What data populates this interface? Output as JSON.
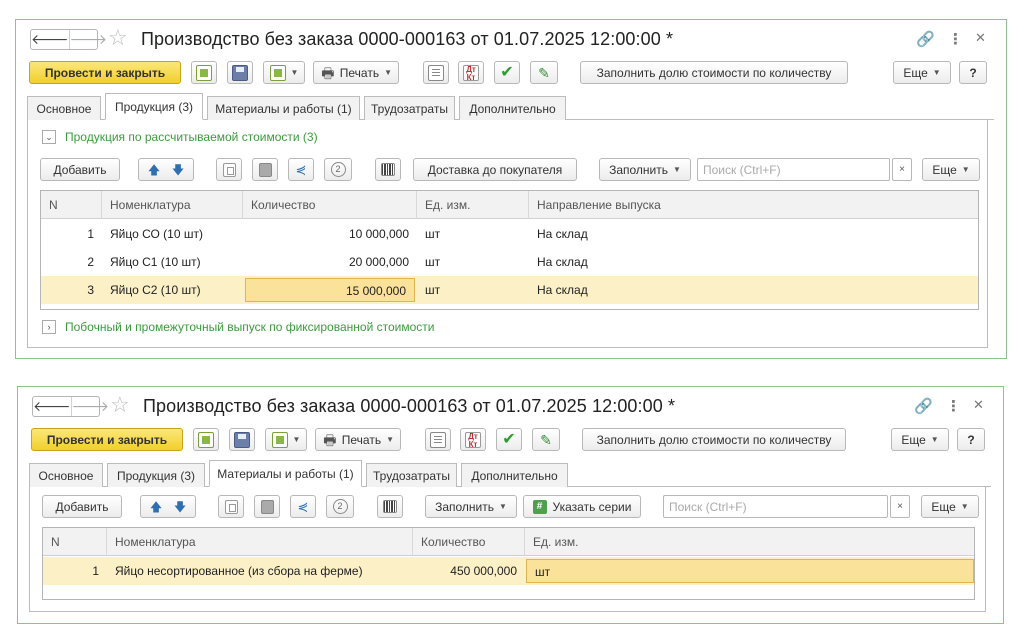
{
  "colors": {
    "accent_green": "#3c9b3c",
    "primary_button": "#f1cf2c",
    "selected_row": "#fbf0c6"
  },
  "window1": {
    "title": "Производство без заказа 0000-000163 от 01.07.2025 12:00:00 *",
    "toolbar": {
      "post_close": "Провести и закрыть",
      "print": "Печать",
      "fill_cost": "Заполнить долю стоимости по количеству",
      "more": "Еще",
      "help": "?"
    },
    "tabs": [
      "Основное",
      "Продукция (3)",
      "Материалы и работы (1)",
      "Трудозатраты",
      "Дополнительно"
    ],
    "group_calc": "Продукция по рассчитываемой стоимости (3)",
    "table_toolbar": {
      "add": "Добавить",
      "delivery": "Доставка до покупателя",
      "fill": "Заполнить",
      "search_placeholder": "Поиск (Ctrl+F)",
      "clear": "×",
      "more": "Еще"
    },
    "columns": [
      "N",
      "Номенклатура",
      "Количество",
      "Ед. изм.",
      "Направление выпуска"
    ],
    "rows": [
      {
        "n": "1",
        "item": "Яйцо СО (10 шт)",
        "qty": "10 000,000",
        "unit": "шт",
        "direction": "На склад"
      },
      {
        "n": "2",
        "item": "Яйцо С1 (10 шт)",
        "qty": "20 000,000",
        "unit": "шт",
        "direction": "На склад"
      },
      {
        "n": "3",
        "item": "Яйцо С2 (10 шт)",
        "qty": "15 000,000",
        "unit": "шт",
        "direction": "На склад"
      }
    ],
    "group_fixed": "Побочный и промежуточный выпуск по фиксированной стоимости"
  },
  "window2": {
    "title": "Производство без заказа 0000-000163 от 01.07.2025 12:00:00 *",
    "toolbar": {
      "post_close": "Провести и закрыть",
      "print": "Печать",
      "fill_cost": "Заполнить долю стоимости по количеству",
      "more": "Еще",
      "help": "?"
    },
    "tabs": [
      "Основное",
      "Продукция (3)",
      "Материалы и работы (1)",
      "Трудозатраты",
      "Дополнительно"
    ],
    "table_toolbar": {
      "add": "Добавить",
      "fill": "Заполнить",
      "series": "Указать серии",
      "search_placeholder": "Поиск (Ctrl+F)",
      "clear": "×",
      "more": "Еще"
    },
    "columns": [
      "N",
      "Номенклатура",
      "Количество",
      "Ед. изм."
    ],
    "rows": [
      {
        "n": "1",
        "item": "Яйцо несортированное (из сбора на ферме)",
        "qty": "450 000,000",
        "unit": "шт"
      }
    ]
  }
}
